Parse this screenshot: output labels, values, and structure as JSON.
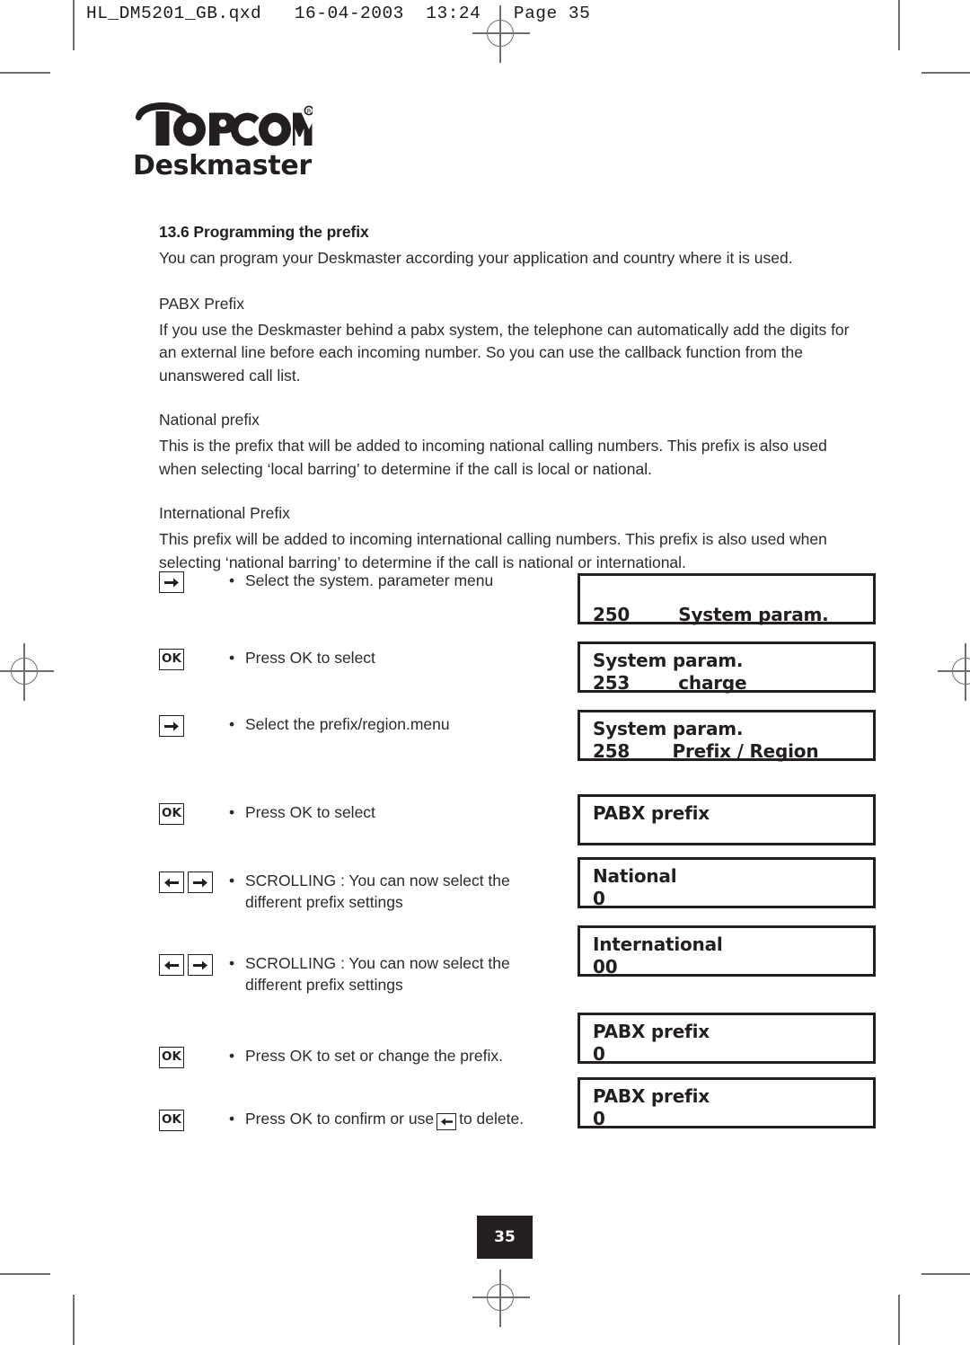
{
  "print_header": {
    "text": "HL_DM5201_GB.qxd   16-04-2003  13:24   Page 35"
  },
  "logo": {
    "wordmark": "TOPCOM",
    "registered": "®",
    "product": "Deskmaster"
  },
  "sections": {
    "heading": "13.6 Programming the prefix",
    "intro": "You can program your Deskmaster according your application and country where it is used.",
    "pabx_title": "PABX Prefix",
    "pabx_body": "If you use the Deskmaster behind a pabx system, the telephone can automatically add the digits for an external line before each incoming number. So you can use the callback function from the unanswered call list.",
    "national_title": "National prefix",
    "national_body": "This is the prefix that will be added to incoming national calling numbers. This prefix is also used when selecting ‘local barring’ to determine if the call is local or national.",
    "international_title": "International Prefix",
    "international_body": "This prefix will be added to incoming international calling numbers. This prefix is also used when selecting ‘national barring’ to determine if the call is national or international."
  },
  "steps": [
    {
      "keys": [
        "arrow-right"
      ],
      "bullet": "•",
      "text": "Select the system. parameter menu"
    },
    {
      "keys": [
        "ok"
      ],
      "bullet": "•",
      "text": "Press OK to select"
    },
    {
      "keys": [
        "arrow-right"
      ],
      "bullet": "•",
      "text": "Select the prefix/region.menu"
    },
    {
      "keys": [
        "ok"
      ],
      "bullet": "•",
      "text": "Press OK to select"
    },
    {
      "keys": [
        "arrow-left",
        "arrow-right"
      ],
      "bullet": "•",
      "text": "SCROLLING : You can now select the different prefix settings"
    },
    {
      "keys": [
        "arrow-left",
        "arrow-right"
      ],
      "bullet": "•",
      "text": "SCROLLING : You can now select the different prefix settings"
    },
    {
      "keys": [
        "ok"
      ],
      "bullet": "•",
      "text": "Press OK to set or change the prefix."
    },
    {
      "keys": [
        "ok"
      ],
      "bullet": "•",
      "text_before": "Press OK to confirm  or use",
      "inline_key": "arrow-left",
      "text_after": "to delete."
    }
  ],
  "displays": [
    {
      "line1": "",
      "line2": "250        System param."
    },
    {
      "line1": "System param.",
      "line2": "253        charge"
    },
    {
      "line1": "System param.",
      "line2": "258       Prefix / Region"
    },
    {
      "line1": "PABX prefix",
      "line2": ""
    },
    {
      "line1": "National",
      "line2": "0"
    },
    {
      "line1": "International",
      "line2": "00"
    },
    {
      "line1": "PABX prefix",
      "line2": "0"
    },
    {
      "line1": "PABX prefix",
      "line2": "0"
    }
  ],
  "footer": {
    "page_number": "35"
  },
  "colors": {
    "ink": "#231f20",
    "body_text": "#2b2b2b",
    "marks": "#6f6f6f"
  }
}
